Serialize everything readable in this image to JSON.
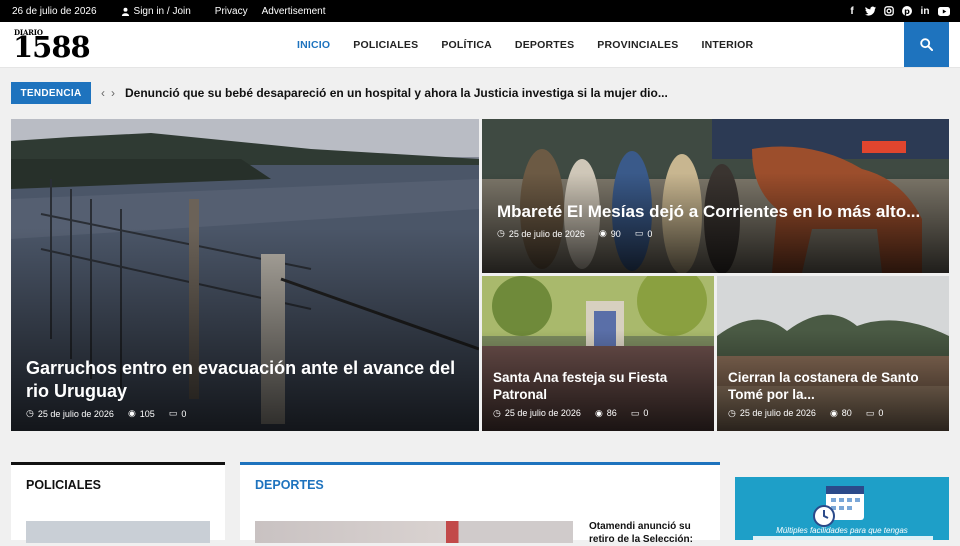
{
  "topbar": {
    "date": "26 de julio de 2026",
    "signin": "Sign in / Join",
    "links": [
      "Privacy",
      "Advertisement"
    ],
    "social": [
      "facebook-icon",
      "twitter-icon",
      "instagram-icon",
      "pinterest-icon",
      "linkedin-icon",
      "youtube-icon"
    ]
  },
  "logo": {
    "small": "DIARIO",
    "big": "1588"
  },
  "nav": [
    "INICIO",
    "POLICIALES",
    "POLÍTICA",
    "DEPORTES",
    "PROVINCIALES",
    "INTERIOR"
  ],
  "trending": {
    "label": "TENDENCIA",
    "headline": "Denunció que su bebé desapareció en un hospital y ahora la Justicia investiga si la mujer dio..."
  },
  "hero": [
    {
      "title": "Garruchos entro en evacuación ante el avance del rio Uruguay",
      "date": "25 de julio de 2026",
      "views": "105",
      "comments": "0"
    },
    {
      "title": "Mbareté El Mesías dejó a Corrientes en lo más alto...",
      "date": "25 de julio de 2026",
      "views": "90",
      "comments": "0"
    },
    {
      "title": "Santa Ana festeja su Fiesta Patronal",
      "date": "25 de julio de 2026",
      "views": "86",
      "comments": "0"
    },
    {
      "title": "Cierran la costanera de Santo Tomé por la...",
      "date": "25 de julio de 2026",
      "views": "80",
      "comments": "0"
    }
  ],
  "sections": {
    "policiales": "POLICIALES",
    "deportes": "DEPORTES",
    "deportes_article": "Otamendi anunció su retiro de la Selección:"
  },
  "ad": {
    "text": "Múltiples facilidades para que tengas"
  },
  "colors": {
    "accent": "#1e73be",
    "topbar": "#000000"
  }
}
